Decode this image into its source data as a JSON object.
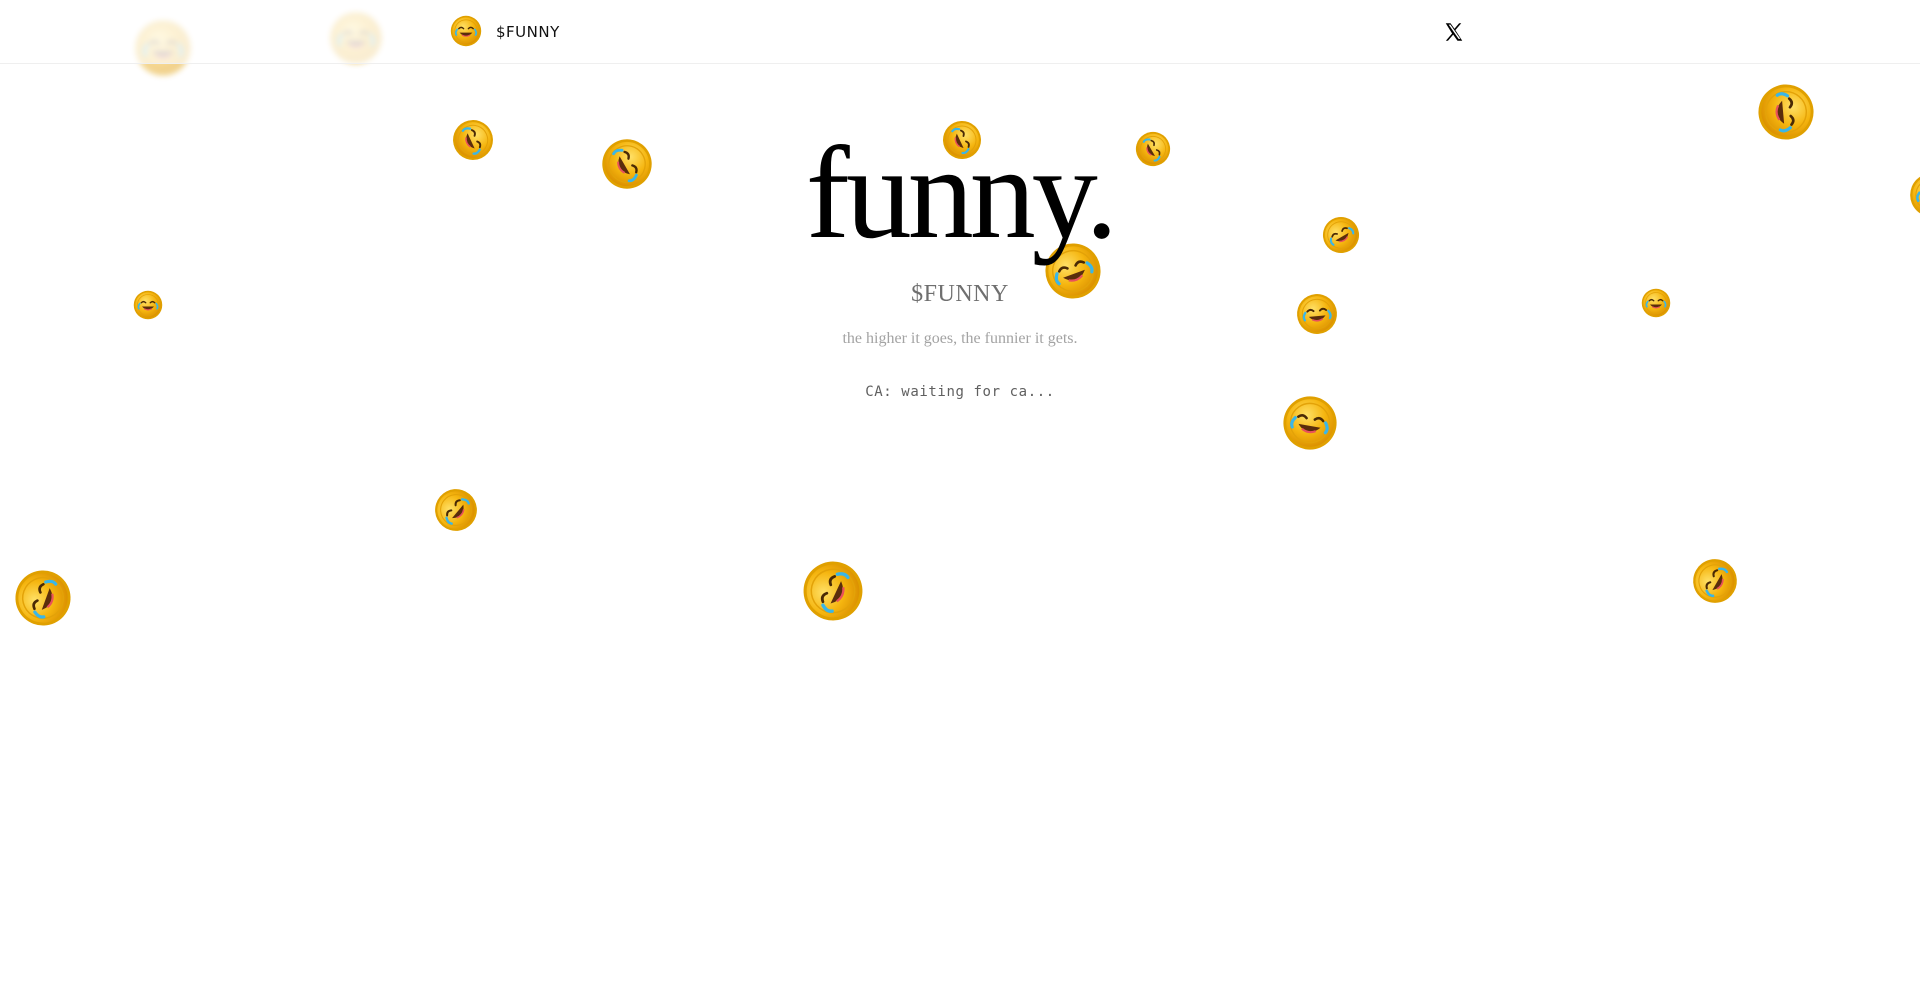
{
  "header": {
    "brand": "$FUNNY",
    "logo_icon": "laughing-coin-icon",
    "social_icon": "x-logo-icon"
  },
  "hero": {
    "title": "funny.",
    "ticker": "$FUNNY",
    "tagline": "the higher it goes, the funnier it gets.",
    "contract": "CA: waiting for ca..."
  },
  "background": {
    "coin_icon": "laughing-coin-icon",
    "coin_color": "#f5b50f"
  }
}
